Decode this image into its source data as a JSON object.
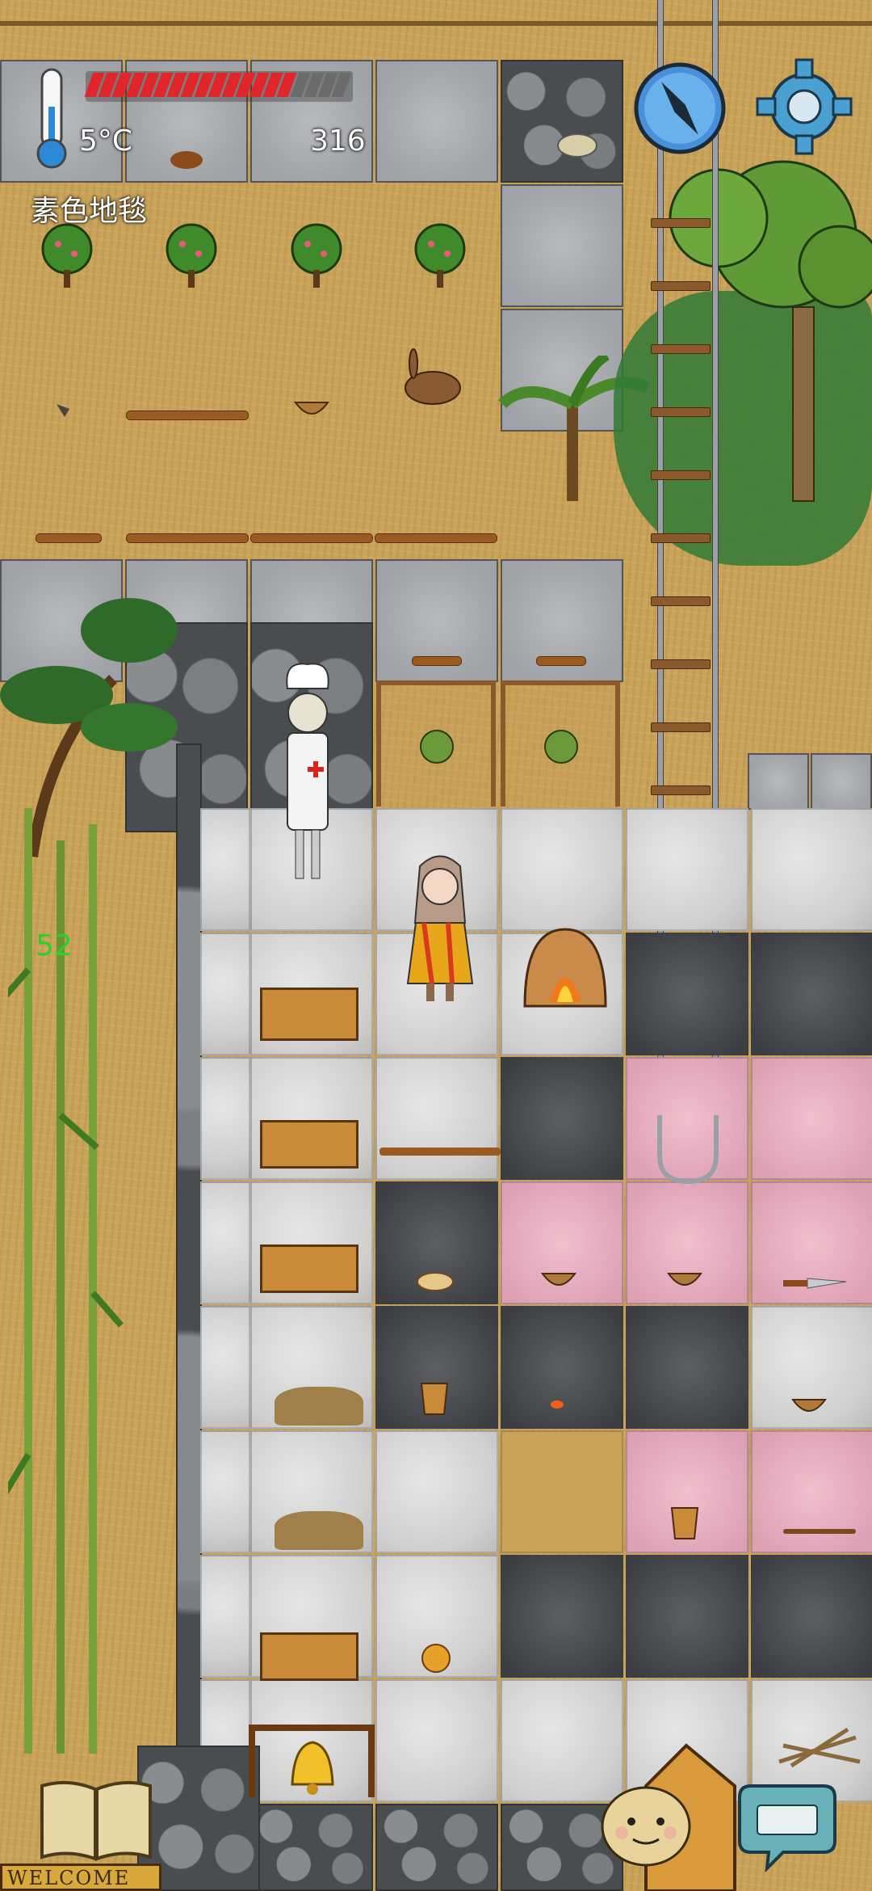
{
  "hud": {
    "temperature": "5°C",
    "hunger_value": "316",
    "hunger_filled": 15,
    "hunger_total": 19,
    "held_item": "素色地毯",
    "floating_number": "52"
  },
  "signs": {
    "welcome": "WELCOME"
  },
  "icons": {
    "compass": "compass-icon",
    "settings": "gear-icon",
    "recipe_book": "book-icon",
    "emote": "emote-face-icon",
    "keyboard": "keyboard-icon",
    "thermometer": "thermometer-icon",
    "bell": "bell-icon"
  },
  "colors": {
    "hunger_fill": "#e0262a",
    "hunger_empty": "#6b6b6b",
    "floating_number": "#2bd12b"
  }
}
